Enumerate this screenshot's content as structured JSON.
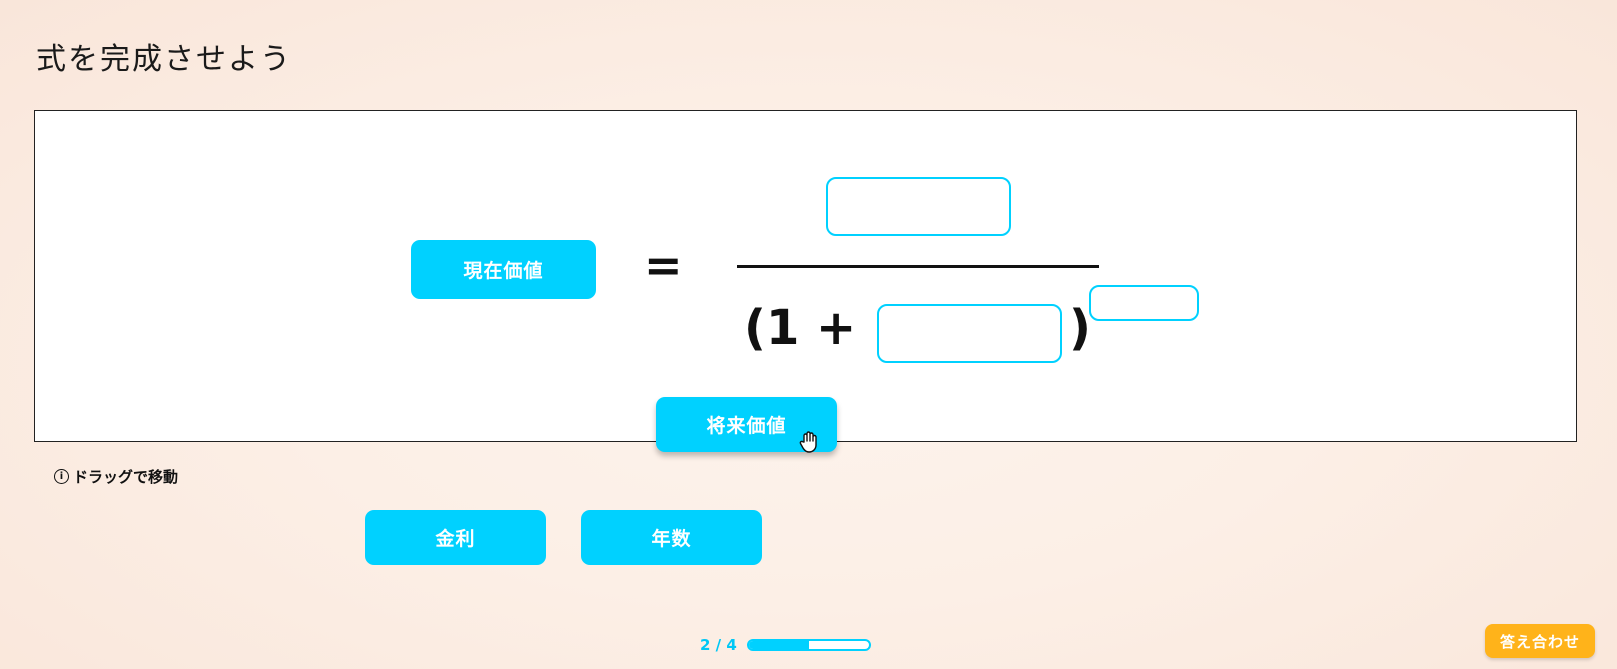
{
  "page": {
    "title": "式を完成させよう",
    "hint": "ドラッグで移動",
    "check_button": "答え合わせ"
  },
  "equation": {
    "lhs_chip": "現在価値",
    "equals": "=",
    "denominator_prefix": "(1 +",
    "close_paren": ")"
  },
  "chips": {
    "dragging": "将来価値",
    "pool": [
      "金利",
      "年数"
    ]
  },
  "progress": {
    "label": "2 / 4",
    "current": 2,
    "total": 4,
    "fraction": 0.5
  },
  "colors": {
    "accent": "#00d1ff",
    "button": "#ffb31a"
  },
  "icons": {
    "info": "info-icon",
    "cursor": "grab-hand-icon"
  }
}
